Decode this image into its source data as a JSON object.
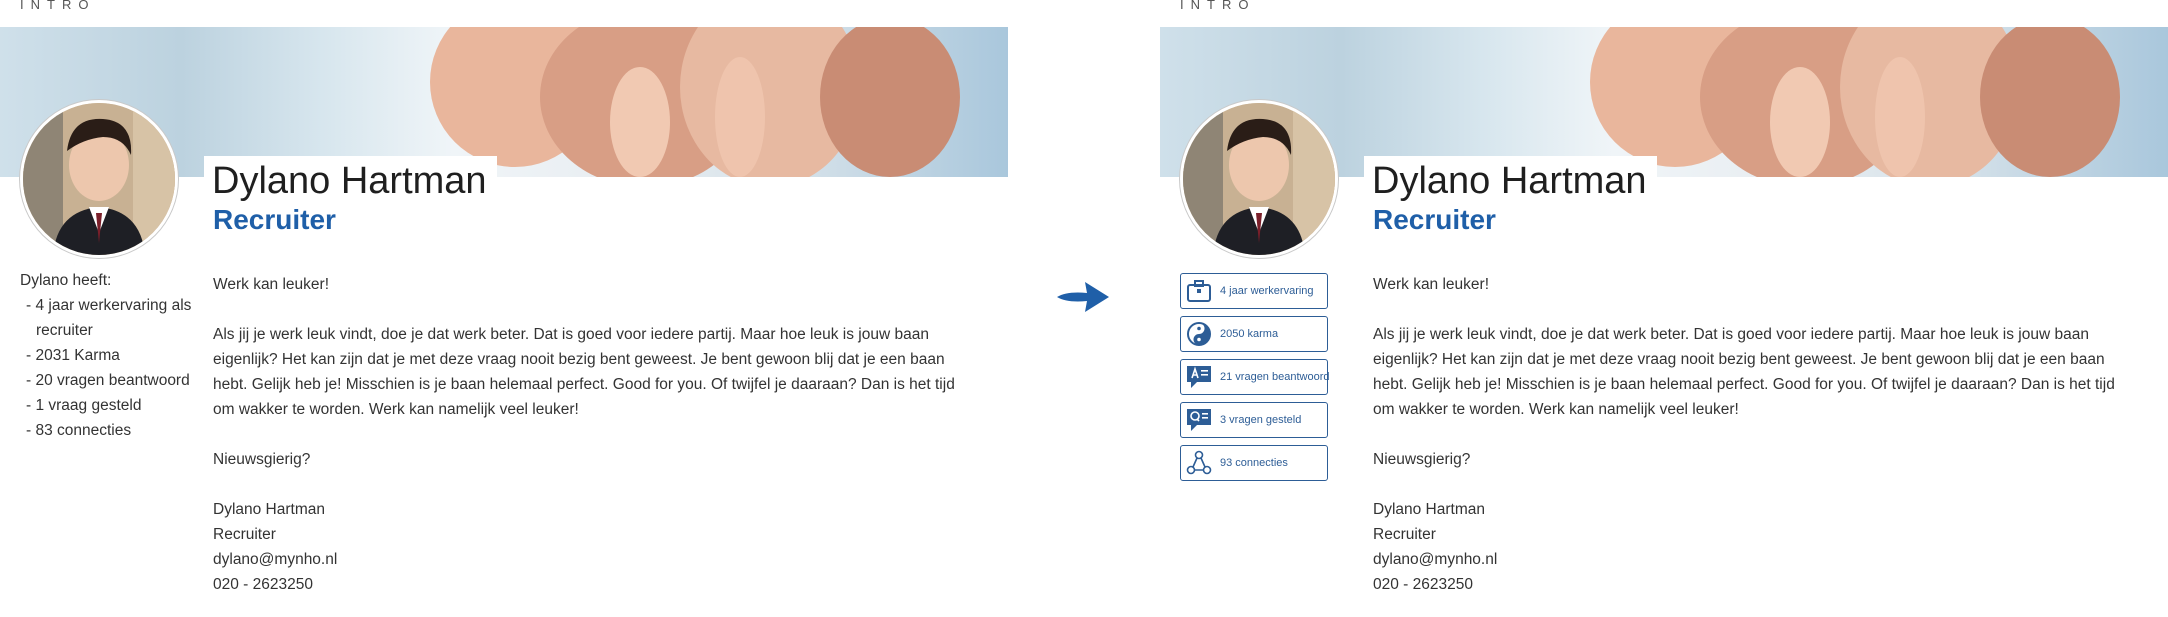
{
  "section_label": "INTRO",
  "profile": {
    "name": "Dylano Hartman",
    "role": "Recruiter",
    "greeting": "Werk kan leuker!",
    "paragraph": "Als jij je werk leuk vindt, doe je dat werk beter. Dat is goed voor iedere partij. Maar hoe leuk is jouw baan eigenlijk? Het kan zijn dat je met deze vraag nooit bezig bent geweest. Je bent gewoon blij dat je een baan hebt. Gelijk heb je! Misschien is je baan helemaal perfect. Good for you. Of twijfel je daaraan? Dan is het tijd om wakker te worden. Werk kan namelijk veel leuker!",
    "question": "Nieuwsgierig?",
    "signature": {
      "name": "Dylano Hartman",
      "role": "Recruiter",
      "email": "dylano@mynho.nl",
      "phone": "020 - 2623250"
    }
  },
  "old_stats": {
    "heading": "Dylano heeft:",
    "items": [
      "- 4 jaar werkervaring als",
      "recruiter",
      "- 2031 Karma",
      "- 20 vragen beantwoord",
      "- 1 vraag gesteld",
      "- 83 connecties"
    ]
  },
  "new_stats": [
    {
      "icon": "briefcase-icon",
      "label": "4 jaar werkervaring"
    },
    {
      "icon": "yin-yang-icon",
      "label": "2050 karma"
    },
    {
      "icon": "answer-icon",
      "label": "21 vragen beantwoord"
    },
    {
      "icon": "question-icon",
      "label": "3 vragen gesteld"
    },
    {
      "icon": "network-icon",
      "label": "93 connecties"
    }
  ],
  "colors": {
    "accent": "#1f5fa8",
    "button_border": "#2d5d96",
    "text": "#333333"
  }
}
